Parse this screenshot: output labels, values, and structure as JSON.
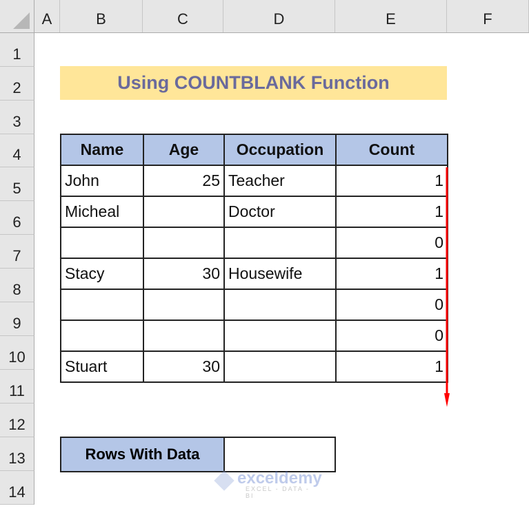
{
  "columns": [
    "A",
    "B",
    "C",
    "D",
    "E",
    "F"
  ],
  "rows": [
    "1",
    "2",
    "3",
    "4",
    "5",
    "6",
    "7",
    "8",
    "9",
    "10",
    "11",
    "12",
    "13",
    "14"
  ],
  "title": "Using COUNTBLANK Function",
  "table": {
    "headers": [
      "Name",
      "Age",
      "Occupation",
      "Count"
    ],
    "rows": [
      [
        "John",
        "25",
        "Teacher",
        "1"
      ],
      [
        "Micheal",
        "",
        "Doctor",
        "1"
      ],
      [
        "",
        "",
        "",
        "0"
      ],
      [
        "Stacy",
        "30",
        "Housewife",
        "1"
      ],
      [
        "",
        "",
        "",
        "0"
      ],
      [
        "",
        "",
        "",
        "0"
      ],
      [
        "Stuart",
        "30",
        "",
        "1"
      ]
    ]
  },
  "summary": {
    "label": "Rows With Data",
    "value": ""
  },
  "watermark": {
    "name": "exceldemy",
    "tagline": "EXCEL - DATA - BI"
  },
  "colors": {
    "title_bg": "#ffe699",
    "title_text": "#6a6a9c",
    "header_bg": "#b4c6e7",
    "arrow": "#ff0000"
  }
}
